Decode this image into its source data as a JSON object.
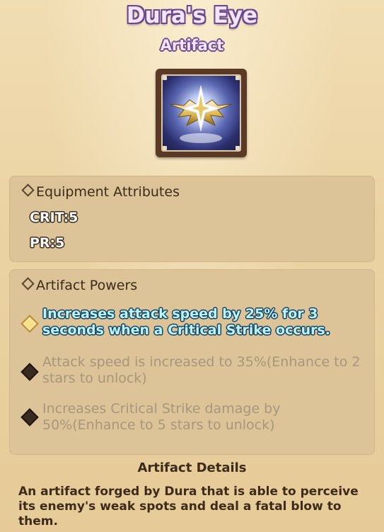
{
  "item": {
    "name": "Dura's Eye",
    "type": "Artifact",
    "icon": "artifact-crown-icon"
  },
  "attributes": {
    "heading": "Equipment Attributes",
    "stats": [
      "CRIT:5",
      "PR:5"
    ]
  },
  "powers": {
    "heading": "Artifact Powers",
    "items": [
      {
        "text": "Increases attack speed by 25% for 3 seconds when a Critical Strike occurs.",
        "state": "active"
      },
      {
        "text": "Attack speed is increased to 35%(Enhance to 2 stars to unlock)",
        "state": "locked"
      },
      {
        "text": "Increases Critical Strike damage by 50%(Enhance to 5 stars to unlock)",
        "state": "locked"
      }
    ]
  },
  "details": {
    "heading": "Artifact Details",
    "text": "An artifact forged by Dura that is able to perceive its enemy's weak spots and deal a fatal blow to them."
  },
  "colors": {
    "background": "#ecd4a6",
    "panel": "#dcc498",
    "title_fill": "#f3e4ff",
    "title_outline": "#6b4a8c",
    "active_power": "#b6f6ff",
    "locked_power": "#a8957c"
  }
}
